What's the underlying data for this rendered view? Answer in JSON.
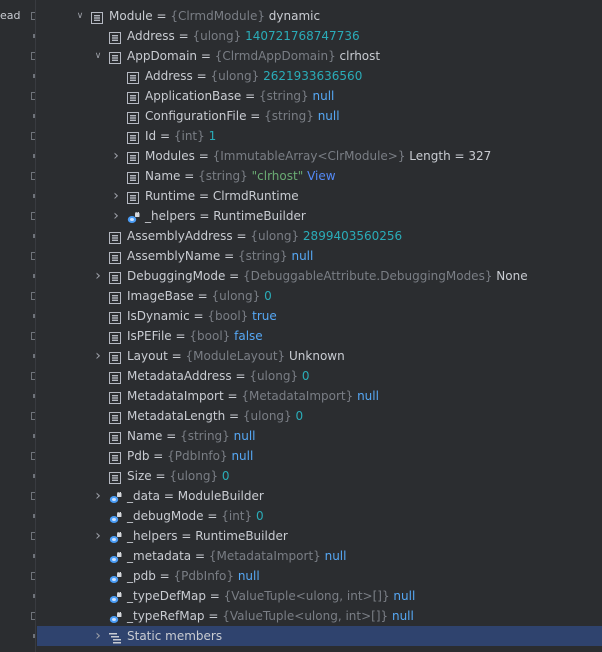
{
  "gutter": {
    "label": "ead"
  },
  "rows": [
    {
      "depth": 0,
      "toggle": "expanded",
      "icon": "class",
      "name": "Module",
      "type": "{ClrmdModule}",
      "value": "dynamic",
      "vclass": "val",
      "link": ""
    },
    {
      "depth": 1,
      "toggle": "none",
      "icon": "field",
      "name": "Address",
      "type": "{ulong}",
      "value": "140721768747736",
      "vclass": "num",
      "link": ""
    },
    {
      "depth": 1,
      "toggle": "expanded",
      "icon": "field",
      "name": "AppDomain",
      "type": "{ClrmdAppDomain}",
      "value": "clrhost",
      "vclass": "val",
      "link": ""
    },
    {
      "depth": 2,
      "toggle": "none",
      "icon": "field",
      "name": "Address",
      "type": "{ulong}",
      "value": "2621933636560",
      "vclass": "num",
      "link": ""
    },
    {
      "depth": 2,
      "toggle": "none",
      "icon": "field",
      "name": "ApplicationBase",
      "type": "{string}",
      "value": "null",
      "vclass": "kw",
      "link": ""
    },
    {
      "depth": 2,
      "toggle": "none",
      "icon": "field",
      "name": "ConfigurationFile",
      "type": "{string}",
      "value": "null",
      "vclass": "kw",
      "link": ""
    },
    {
      "depth": 2,
      "toggle": "none",
      "icon": "field",
      "name": "Id",
      "type": "{int}",
      "value": "1",
      "vclass": "num",
      "link": ""
    },
    {
      "depth": 2,
      "toggle": "collapsed",
      "icon": "field",
      "name": "Modules",
      "type": "{ImmutableArray<ClrModule>}",
      "value": "Length = 327",
      "vclass": "val",
      "link": ""
    },
    {
      "depth": 2,
      "toggle": "none",
      "icon": "field",
      "name": "Name",
      "type": "{string}",
      "value": "\"clrhost\"",
      "vclass": "str",
      "link": "View"
    },
    {
      "depth": 2,
      "toggle": "collapsed",
      "icon": "field",
      "name": "Runtime",
      "type": "",
      "value": "ClrmdRuntime",
      "vclass": "val",
      "link": ""
    },
    {
      "depth": 2,
      "toggle": "collapsed",
      "icon": "private",
      "name": "_helpers",
      "type": "",
      "value": "RuntimeBuilder",
      "vclass": "val",
      "link": ""
    },
    {
      "depth": 1,
      "toggle": "none",
      "icon": "field",
      "name": "AssemblyAddress",
      "type": "{ulong}",
      "value": "2899403560256",
      "vclass": "num",
      "link": ""
    },
    {
      "depth": 1,
      "toggle": "none",
      "icon": "field",
      "name": "AssemblyName",
      "type": "{string}",
      "value": "null",
      "vclass": "kw",
      "link": ""
    },
    {
      "depth": 1,
      "toggle": "collapsed",
      "icon": "field",
      "name": "DebuggingMode",
      "type": "{DebuggableAttribute.DebuggingModes}",
      "value": "None",
      "vclass": "val",
      "link": ""
    },
    {
      "depth": 1,
      "toggle": "none",
      "icon": "field",
      "name": "ImageBase",
      "type": "{ulong}",
      "value": "0",
      "vclass": "num",
      "link": ""
    },
    {
      "depth": 1,
      "toggle": "none",
      "icon": "field",
      "name": "IsDynamic",
      "type": "{bool}",
      "value": "true",
      "vclass": "kw",
      "link": ""
    },
    {
      "depth": 1,
      "toggle": "none",
      "icon": "field",
      "name": "IsPEFile",
      "type": "{bool}",
      "value": "false",
      "vclass": "kw",
      "link": ""
    },
    {
      "depth": 1,
      "toggle": "collapsed",
      "icon": "field",
      "name": "Layout",
      "type": "{ModuleLayout}",
      "value": "Unknown",
      "vclass": "val",
      "link": ""
    },
    {
      "depth": 1,
      "toggle": "none",
      "icon": "field",
      "name": "MetadataAddress",
      "type": "{ulong}",
      "value": "0",
      "vclass": "num",
      "link": ""
    },
    {
      "depth": 1,
      "toggle": "none",
      "icon": "field",
      "name": "MetadataImport",
      "type": "{MetadataImport}",
      "value": "null",
      "vclass": "kw",
      "link": ""
    },
    {
      "depth": 1,
      "toggle": "none",
      "icon": "field",
      "name": "MetadataLength",
      "type": "{ulong}",
      "value": "0",
      "vclass": "num",
      "link": ""
    },
    {
      "depth": 1,
      "toggle": "none",
      "icon": "field",
      "name": "Name",
      "type": "{string}",
      "value": "null",
      "vclass": "kw",
      "link": ""
    },
    {
      "depth": 1,
      "toggle": "none",
      "icon": "field",
      "name": "Pdb",
      "type": "{PdbInfo}",
      "value": "null",
      "vclass": "kw",
      "link": ""
    },
    {
      "depth": 1,
      "toggle": "none",
      "icon": "field",
      "name": "Size",
      "type": "{ulong}",
      "value": "0",
      "vclass": "num",
      "link": ""
    },
    {
      "depth": 1,
      "toggle": "collapsed",
      "icon": "private",
      "name": "_data",
      "type": "",
      "value": "ModuleBuilder",
      "vclass": "val",
      "link": ""
    },
    {
      "depth": 1,
      "toggle": "none",
      "icon": "private",
      "name": "_debugMode",
      "type": "{int}",
      "value": "0",
      "vclass": "num",
      "link": ""
    },
    {
      "depth": 1,
      "toggle": "collapsed",
      "icon": "private",
      "name": "_helpers",
      "type": "",
      "value": "RuntimeBuilder",
      "vclass": "val",
      "link": ""
    },
    {
      "depth": 1,
      "toggle": "none",
      "icon": "private",
      "name": "_metadata",
      "type": "{MetadataImport}",
      "value": "null",
      "vclass": "kw",
      "link": ""
    },
    {
      "depth": 1,
      "toggle": "none",
      "icon": "private",
      "name": "_pdb",
      "type": "{PdbInfo}",
      "value": "null",
      "vclass": "kw",
      "link": ""
    },
    {
      "depth": 1,
      "toggle": "none",
      "icon": "private",
      "name": "_typeDefMap",
      "type": "{ValueTuple<ulong, int>[]}",
      "value": "null",
      "vclass": "kw",
      "link": ""
    },
    {
      "depth": 1,
      "toggle": "none",
      "icon": "private",
      "name": "_typeRefMap",
      "type": "{ValueTuple<ulong, int>[]}",
      "value": "null",
      "vclass": "kw",
      "link": ""
    },
    {
      "depth": 1,
      "toggle": "collapsed",
      "icon": "static",
      "name": "Static members",
      "type": "",
      "value": "",
      "vclass": "val",
      "link": "",
      "selected": true
    }
  ]
}
